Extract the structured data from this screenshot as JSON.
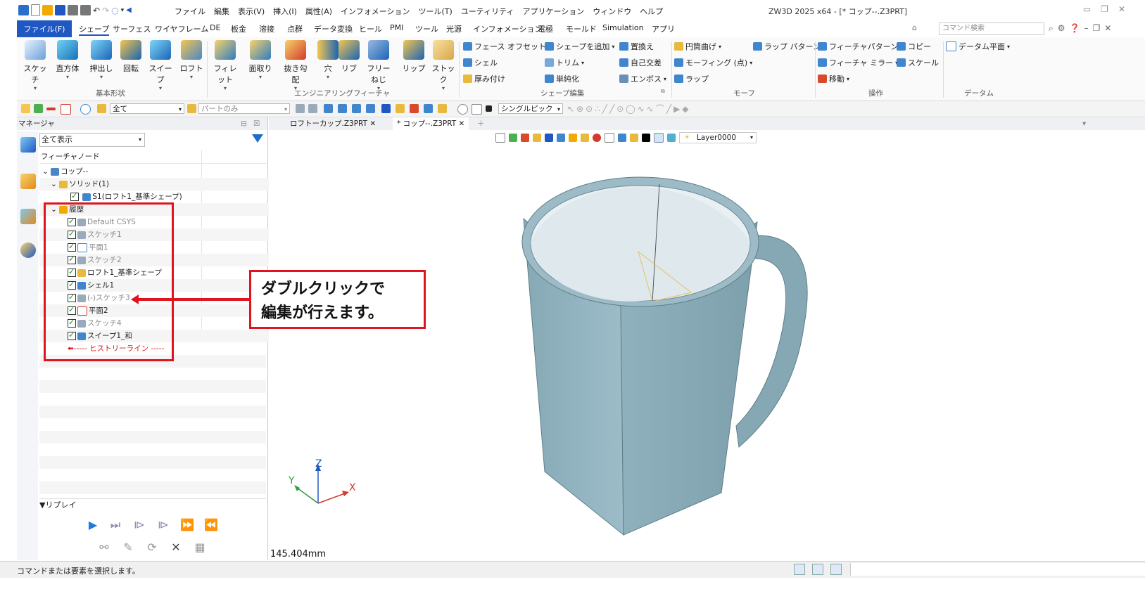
{
  "quick_access_menu": [
    "ファイル",
    "編集",
    "表示(V)",
    "挿入(I)",
    "属性(A)",
    "インフォメーション",
    "ツール(T)",
    "ユーティリティ",
    "アプリケーション",
    "ウィンドウ",
    "ヘルプ"
  ],
  "app_title": "ZW3D 2025 x64 - [* コップ--.Z3PRT]",
  "ribbon_tabs": {
    "file": "ファイル(F)",
    "tabs": [
      "シェープ",
      "サーフェス",
      "ワイヤフレーム",
      "DE",
      "板金",
      "溶接",
      "点群",
      "データ変換",
      "ヒール",
      "PMI",
      "ツール",
      "光源",
      "インフォメーション",
      "電極",
      "モールド",
      "Simulation",
      "アプリ"
    ],
    "search_placeholder": "コマンド検索"
  },
  "ribbon": {
    "basic_shapes": [
      "スケッチ",
      "直方体",
      "押出し",
      "回転",
      "スイープ",
      "ロフト"
    ],
    "basic_label": "基本形状",
    "eng_features": [
      "フィレット",
      "面取り",
      "抜き勾配",
      "穴",
      "リブ",
      "フリーねじ",
      "リップ",
      "ストック"
    ],
    "eng_label": "エンジニアリングフィーチャ",
    "shape_edit": {
      "col1": [
        "フェース オフセット",
        "シェル",
        "厚み付け"
      ],
      "col2": [
        "シェープを追加",
        "トリム",
        "単純化"
      ],
      "col3": [
        "置換え",
        "自己交差",
        "エンボス"
      ],
      "label": "シェープ編集"
    },
    "morph": {
      "col1": [
        "円筒曲げ",
        "モーフィング (点)",
        "ラップ"
      ],
      "col2": [
        "ラップ パターン"
      ],
      "label": "モーフ"
    },
    "operation": {
      "col1": [
        "フィーチャパターン",
        "フィーチャ ミラー",
        "移動"
      ],
      "col2": [
        "コピー",
        "スケール"
      ],
      "label": "操作"
    },
    "datum": {
      "col1": [
        "データム平面"
      ],
      "label": "データム"
    }
  },
  "toolbar2": {
    "filter_value": "全て",
    "part_value": "パートのみ",
    "pick_value": "シングルピック"
  },
  "manager": {
    "title": "マネージャ",
    "filter_value": "全て表示",
    "tree_header": "フィーチャノード",
    "tree": {
      "root": "コップ--",
      "solid": "ソリッド(1)",
      "solid_item": "S1(ロフト1_基準シェープ)",
      "history": "履歴",
      "items": [
        {
          "label": "Default CSYS",
          "grey": true
        },
        {
          "label": "スケッチ1",
          "grey": true
        },
        {
          "label": "平面1",
          "grey": true
        },
        {
          "label": "スケッチ2",
          "grey": true
        },
        {
          "label": "ロフト1_基準シェープ",
          "grey": false
        },
        {
          "label": "シェル1",
          "grey": false
        },
        {
          "label": "(-)スケッチ3",
          "grey": true
        },
        {
          "label": "平面2",
          "grey": false
        },
        {
          "label": "スケッチ4",
          "grey": true
        },
        {
          "label": "スイープ1_和",
          "grey": false
        }
      ],
      "history_line": "----- ヒストリーライン -----"
    },
    "replay_label": "▼リプレイ"
  },
  "doc_tabs": [
    "ロフトーカップ.Z3PRT",
    "* コップ--.Z3PRT"
  ],
  "view": {
    "layer": "Layer0000",
    "scale": "145.404mm",
    "axes": {
      "x": "X",
      "y": "Y",
      "z": "Z"
    }
  },
  "callout": {
    "line1": "ダブルクリックで",
    "line2": "編集が行えます。"
  },
  "status": {
    "text": "コマンドまたは要素を選択します。"
  },
  "colors": {
    "accent": "#1f57c3",
    "highlight_red": "#e0141e",
    "cup": "#8fb0bd"
  }
}
